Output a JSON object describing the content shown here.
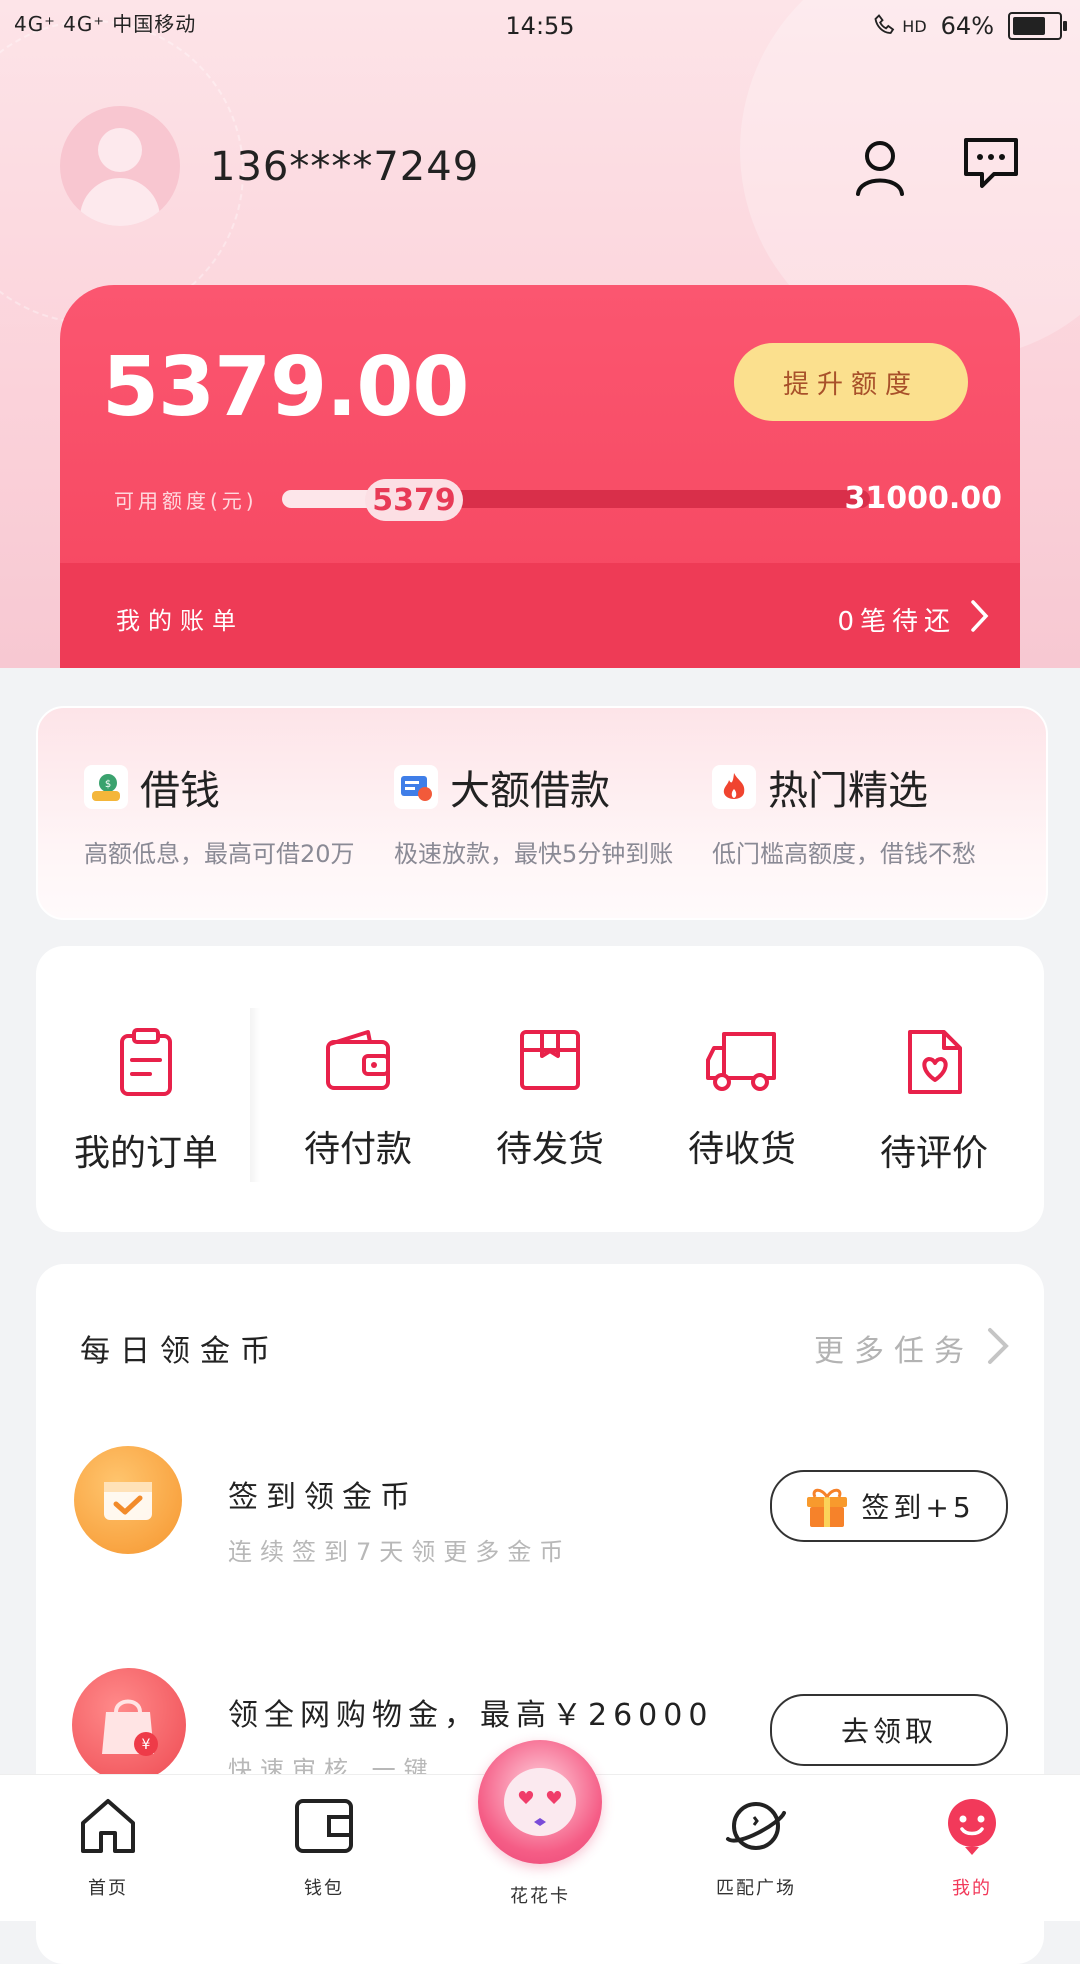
{
  "status_bar": {
    "carrier": "4G⁺ 4G⁺ 中国移动",
    "time": "14:55",
    "battery": "64%",
    "network": "HD"
  },
  "profile": {
    "phone": "136****7249"
  },
  "credit": {
    "available_amount": "5379.00",
    "raise_limit_label": "提升额度",
    "available_label": "可用额度(元)",
    "progress_value": "5379",
    "progress_fraction": 0.173,
    "max_amount": "31000.00",
    "bill_label": "我的账单",
    "pending_count": "0",
    "pending_label": "笔待还"
  },
  "loans": [
    {
      "title": "借钱",
      "desc": "高额低息，最高可借20万",
      "icon": "money-bag-icon"
    },
    {
      "title": "大额借款",
      "desc": "极速放款，最快5分钟到账",
      "icon": "id-card-icon"
    },
    {
      "title": "热门精选",
      "desc": "低门槛高额度，借钱不愁",
      "icon": "fire-icon"
    }
  ],
  "orders": [
    {
      "label": "我的订单",
      "icon": "clipboard-icon"
    },
    {
      "label": "待付款",
      "icon": "wallet-icon"
    },
    {
      "label": "待发货",
      "icon": "box-icon"
    },
    {
      "label": "待收货",
      "icon": "truck-icon"
    },
    {
      "label": "待评价",
      "icon": "heart-note-icon"
    }
  ],
  "coins": {
    "title": "每日领金币",
    "more_label": "更多任务",
    "tasks": [
      {
        "title": "签到领金币",
        "subtitle": "连续签到7天领更多金币",
        "button_label": "签到+5",
        "icon": "calendar-check-icon"
      },
      {
        "title": "领全网购物金，最高￥26000",
        "subtitle": "快速审核  一键",
        "button_label": "去领取",
        "icon": "shopping-bag-icon"
      }
    ]
  },
  "tabbar": {
    "items": [
      {
        "label": "首页",
        "icon": "home-icon"
      },
      {
        "label": "钱包",
        "icon": "wallet-icon"
      },
      {
        "label": "花花卡",
        "icon": "mascot-icon"
      },
      {
        "label": "匹配广场",
        "icon": "planet-icon"
      },
      {
        "label": "我的",
        "icon": "profile-icon"
      }
    ],
    "active_index": 4
  },
  "colors": {
    "brand": "#f5465f",
    "accent_gold": "#fbe08e",
    "active_tab": "#f2395a"
  }
}
